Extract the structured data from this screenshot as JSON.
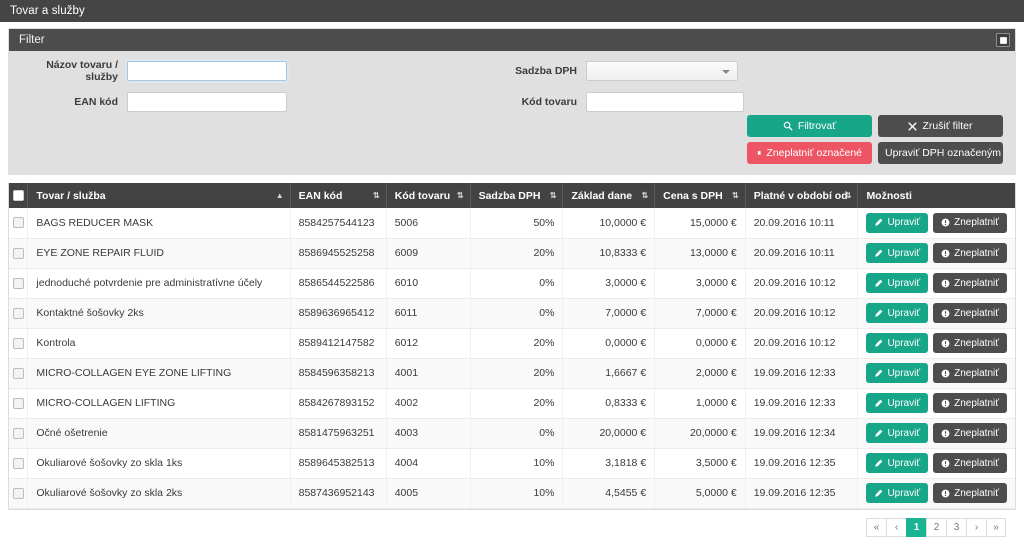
{
  "window": {
    "title": "Tovar a služby"
  },
  "filter": {
    "panel_title": "Filter",
    "collapse_icon": "collapse-window-icon",
    "fields": {
      "name_label": "Názov tovaru / služby",
      "name_value": "",
      "name_placeholder": "",
      "ean_label": "EAN kód",
      "ean_value": "",
      "ean_placeholder": "",
      "vat_label": "Sadzba DPH",
      "vat_value": "",
      "goods_code_label": "Kód tovaru",
      "goods_code_value": "",
      "goods_code_placeholder": ""
    },
    "buttons": {
      "filter": "Filtrovať",
      "clear": "Zrušiť filter",
      "invalidate_selected": "Zneplatniť označené",
      "edit_vat_selected": "Upraviť DPH označeným"
    }
  },
  "table": {
    "columns": [
      {
        "key": "check",
        "label": "",
        "sort": ""
      },
      {
        "key": "name",
        "label": "Tovar / služba",
        "sort": "asc"
      },
      {
        "key": "ean",
        "label": "EAN kód",
        "sort": "both"
      },
      {
        "key": "code",
        "label": "Kód tovaru",
        "sort": "both"
      },
      {
        "key": "rate",
        "label": "Sadzba DPH",
        "sort": "both"
      },
      {
        "key": "base",
        "label": "Základ dane",
        "sort": "both"
      },
      {
        "key": "price",
        "label": "Cena s DPH",
        "sort": "both"
      },
      {
        "key": "date",
        "label": "Platné v období od",
        "sort": "both"
      },
      {
        "key": "options",
        "label": "Možnosti",
        "sort": ""
      }
    ],
    "row_buttons": {
      "edit": "Upraviť",
      "invalidate": "Zneplatniť"
    },
    "rows": [
      {
        "name": "BAGS REDUCER MASK",
        "ean": "8584257544123",
        "code": "5006",
        "rate": "50%",
        "base": "10,0000 €",
        "price": "15,0000 €",
        "date": "20.09.2016 10:11"
      },
      {
        "name": "EYE ZONE REPAIR FLUID",
        "ean": "8586945525258",
        "code": "6009",
        "rate": "20%",
        "base": "10,8333 €",
        "price": "13,0000 €",
        "date": "20.09.2016 10:11"
      },
      {
        "name": "jednoduché potvrdenie pre administratívne účely",
        "ean": "8586544522586",
        "code": "6010",
        "rate": "0%",
        "base": "3,0000 €",
        "price": "3,0000 €",
        "date": "20.09.2016 10:12"
      },
      {
        "name": "Kontaktné šošovky 2ks",
        "ean": "8589636965412",
        "code": "6011",
        "rate": "0%",
        "base": "7,0000 €",
        "price": "7,0000 €",
        "date": "20.09.2016 10:12"
      },
      {
        "name": "Kontrola",
        "ean": "8589412147582",
        "code": "6012",
        "rate": "20%",
        "base": "0,0000 €",
        "price": "0,0000 €",
        "date": "20.09.2016 10:12"
      },
      {
        "name": "MICRO-COLLAGEN EYE ZONE LIFTING",
        "ean": "8584596358213",
        "code": "4001",
        "rate": "20%",
        "base": "1,6667 €",
        "price": "2,0000 €",
        "date": "19.09.2016 12:33"
      },
      {
        "name": "MICRO-COLLAGEN LIFTING",
        "ean": "8584267893152",
        "code": "4002",
        "rate": "20%",
        "base": "0,8333 €",
        "price": "1,0000 €",
        "date": "19.09.2016 12:33"
      },
      {
        "name": "Očné ošetrenie",
        "ean": "8581475963251",
        "code": "4003",
        "rate": "0%",
        "base": "20,0000 €",
        "price": "20,0000 €",
        "date": "19.09.2016 12:34"
      },
      {
        "name": "Okuliarové šošovky zo skla 1ks",
        "ean": "8589645382513",
        "code": "4004",
        "rate": "10%",
        "base": "3,1818 €",
        "price": "3,5000 €",
        "date": "19.09.2016 12:35"
      },
      {
        "name": "Okuliarové šošovky zo skla 2ks",
        "ean": "8587436952143",
        "code": "4005",
        "rate": "10%",
        "base": "4,5455 €",
        "price": "5,0000 €",
        "date": "19.09.2016 12:35"
      }
    ]
  },
  "pagination": {
    "first": "«",
    "prev": "‹",
    "pages": [
      "1",
      "2",
      "3"
    ],
    "active_page": "1",
    "next": "›",
    "last": "»"
  },
  "colors": {
    "titlebar": "#454545",
    "panel_head": "#4c4c4c",
    "filter_body": "#e0e0e0",
    "teal": "#18a689",
    "red": "#ed5565",
    "dark": "#4d4d4d",
    "table_head": "#434343",
    "pager_active": "#1ab394"
  }
}
